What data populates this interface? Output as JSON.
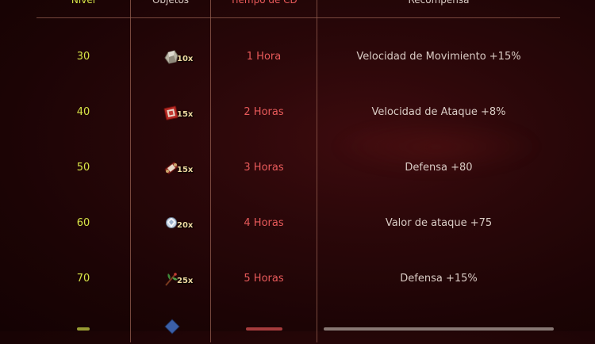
{
  "headers": {
    "level": "Nivel",
    "items": "Objetos",
    "cooldown": "Tiempo de CD",
    "reward": "Recompensa"
  },
  "colors": {
    "level": "#d7e447",
    "cooldown": "#e85a5a",
    "reward": "#d9cbc4",
    "divider": "#965f50"
  },
  "rows": [
    {
      "level": "30",
      "item_icon": "rock-icon",
      "qty": "10x",
      "cooldown": "1 Hora",
      "reward": "Velocidad de Movimiento +15%"
    },
    {
      "level": "40",
      "item_icon": "red-book-icon",
      "qty": "15x",
      "cooldown": "2 Horas",
      "reward": "Velocidad de Ataque +8%"
    },
    {
      "level": "50",
      "item_icon": "scroll-icon",
      "qty": "15x",
      "cooldown": "3 Horas",
      "reward": "Defensa +80"
    },
    {
      "level": "60",
      "item_icon": "diamond-icon",
      "qty": "20x",
      "cooldown": "4 Horas",
      "reward": "Valor de ataque +75"
    },
    {
      "level": "70",
      "item_icon": "herb-icon",
      "qty": "25x",
      "cooldown": "5 Horas",
      "reward": "Defensa +15%"
    }
  ]
}
